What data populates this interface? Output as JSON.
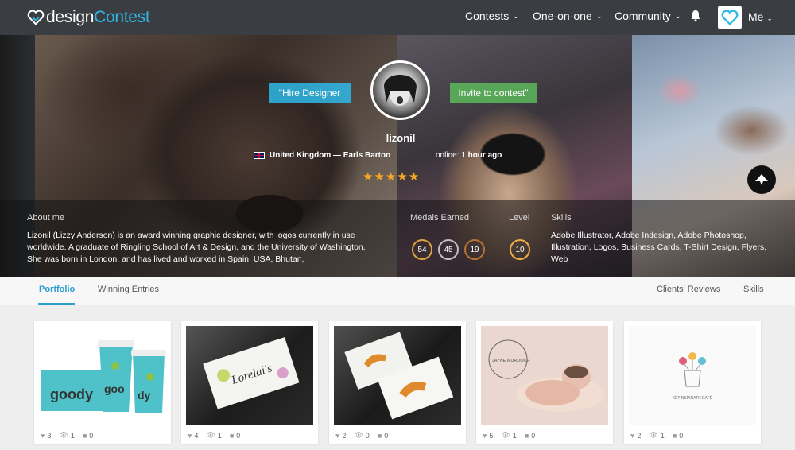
{
  "nav": {
    "logo_pre": "design",
    "logo_accent": "Contest",
    "items": [
      {
        "label": "Contests"
      },
      {
        "label": "One-on-one"
      },
      {
        "label": "Community"
      }
    ],
    "me_label": "Me"
  },
  "hero": {
    "hire_label": "\"Hire Designer",
    "invite_label": "Invite to contest\"",
    "username": "lizonil",
    "location": "United Kingdom — Earls Barton",
    "online_label": "online:",
    "online_value": "1 hour ago",
    "rating": 5,
    "about_label": "About me",
    "about_text": "Lizonil (Lizzy Anderson) is an award winning graphic designer, with logos currently in use worldwide. A graduate of Ringling School of Art & Design, and the University of Washington. She was born in London, and has lived and worked in Spain, USA, Bhutan,",
    "medals_label": "Medals Earned",
    "medals": [
      {
        "value": "54",
        "color": "#d9a441"
      },
      {
        "value": "45",
        "color": "#c0c0c0"
      },
      {
        "value": "19",
        "color": "#b87333"
      }
    ],
    "level_label": "Level",
    "level_value": "10",
    "skills_label": "Skills",
    "skills_text": "Adobe Illustrator, Adobe Indesign, Adobe Photoshop, Illustration, Logos, Business Cards, T-Shirt Design, Flyers, Web"
  },
  "tabs": {
    "portfolio": "Portfolio",
    "winning": "Winning Entries",
    "reviews": "Clients' Reviews",
    "skills": "Skills"
  },
  "cards": [
    {
      "likes": "3",
      "views": "1",
      "comments": "0"
    },
    {
      "likes": "4",
      "views": "1",
      "comments": "0"
    },
    {
      "likes": "2",
      "views": "0",
      "comments": "0"
    },
    {
      "likes": "5",
      "views": "1",
      "comments": "0"
    },
    {
      "likes": "2",
      "views": "1",
      "comments": "0"
    }
  ],
  "card_texts": {
    "card1_brand": "goody",
    "card2_brand": "Lorelai's",
    "card4_brand": "JAYNE MURDOCH",
    "card5_brand": "KÉTINSPIRATIECAFÉ"
  },
  "colors": {
    "accent": "#2eb8e6",
    "nav_bg": "#3a3d42",
    "hire": "#2eb8e6",
    "invite": "#5cb85c",
    "star": "#f5a623",
    "tab_active": "#2b9fd0"
  }
}
